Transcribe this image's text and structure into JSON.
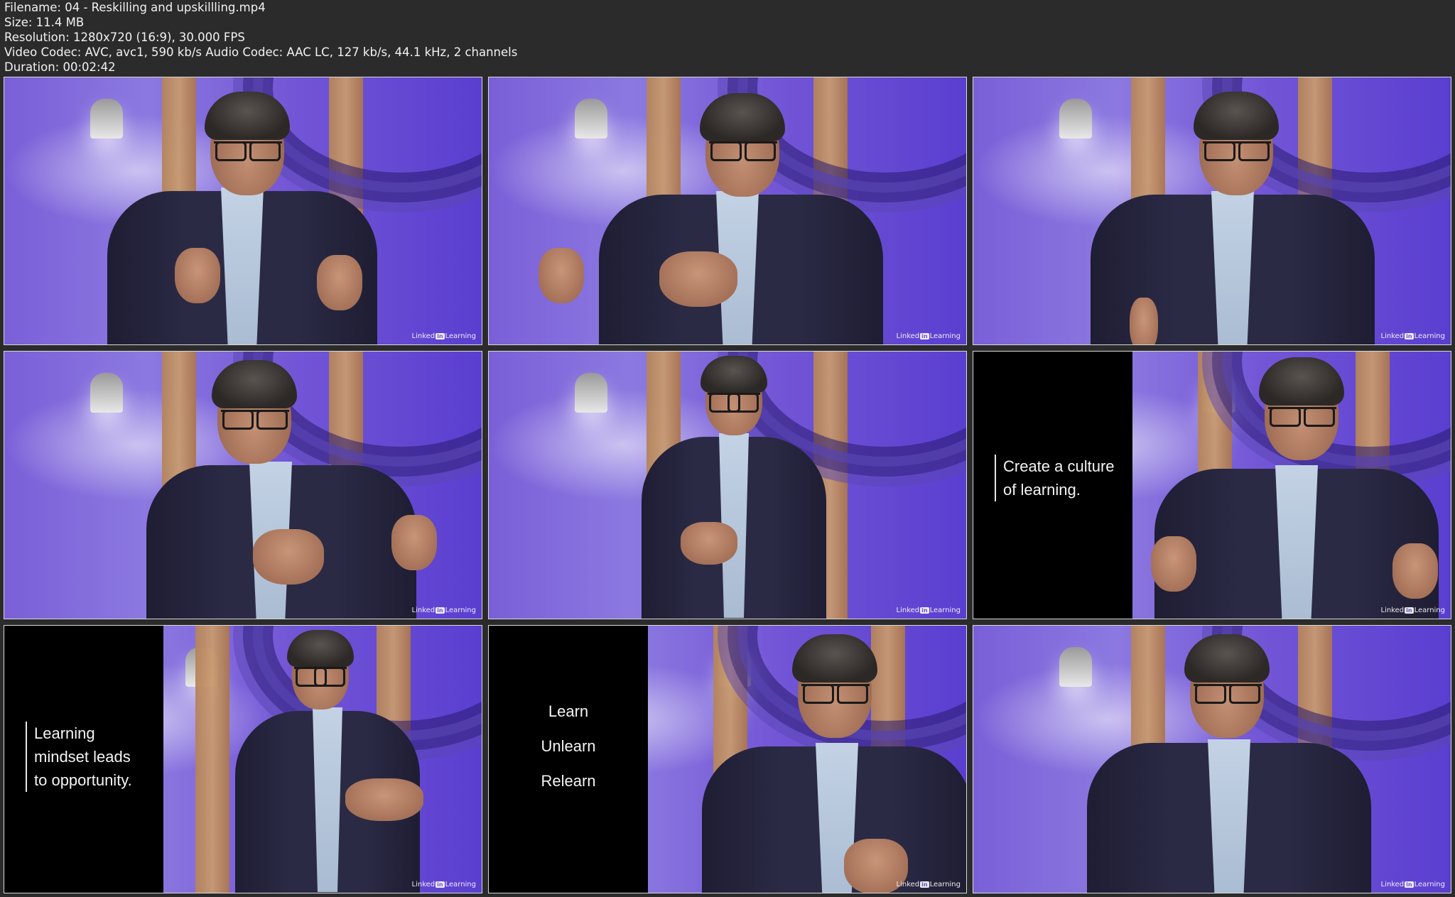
{
  "meta": {
    "filename": "Filename: 04 - Reskilling and upskillling.mp4",
    "size": "Size: 11.4 MB",
    "resolution": "Resolution: 1280x720 (16:9), 30.000 FPS",
    "codec": "Video Codec: AVC, avc1, 590 kb/s Audio Codec: AAC LC, 127 kb/s, 44.1 kHz, 2 channels",
    "duration": "Duration: 00:02:42"
  },
  "logo": {
    "left": "Linked",
    "mark": "in",
    "right": "Learning"
  },
  "captions": {
    "frame6": [
      "Create a culture",
      "of learning."
    ],
    "frame7": [
      "Learning",
      "mindset leads",
      "to opportunity."
    ],
    "frame8": [
      "Learn",
      "Unlearn",
      "Relearn"
    ]
  },
  "colors": {
    "background": "#2b2b2b",
    "scene": "#6f55d6",
    "panel": "#000000"
  }
}
